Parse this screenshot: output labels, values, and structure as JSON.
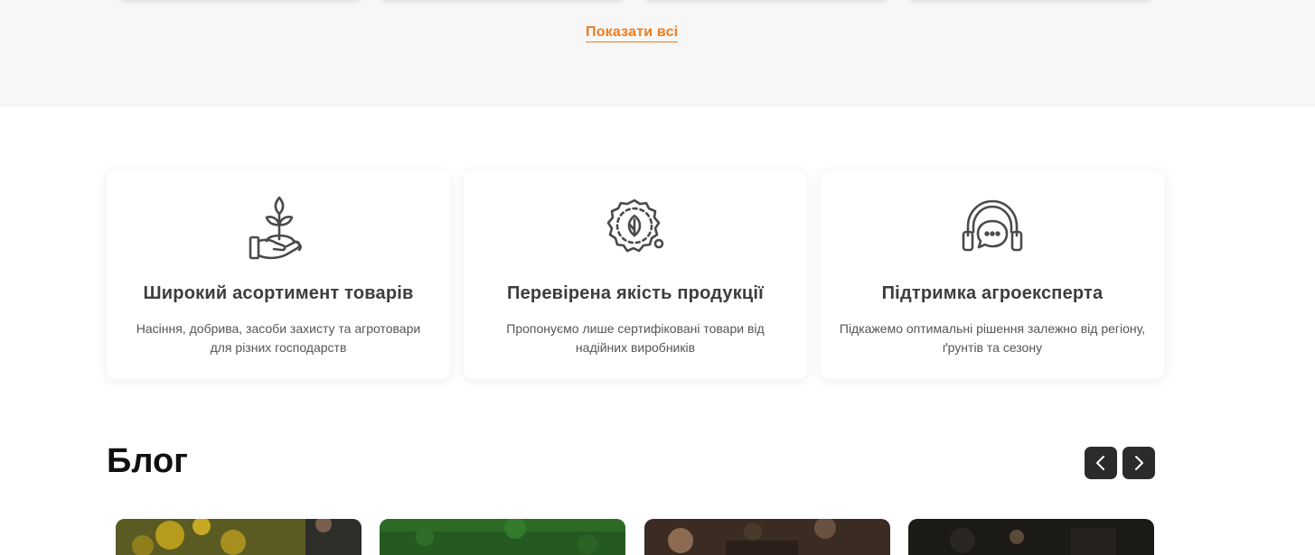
{
  "top": {
    "show_all_label": "Показати всі"
  },
  "features": [
    {
      "icon": "plant-hand-icon",
      "title": "Широкий асортимент товарів",
      "description": "Насіння, добрива, засоби захисту та агротовари для різних господарств"
    },
    {
      "icon": "quality-badge-icon",
      "title": "Перевірена якість продукції",
      "description": "Пропонуємо лише сертифіковані товари від надійних виробників"
    },
    {
      "icon": "headset-support-icon",
      "title": "Підтримка агроексперта",
      "description": "Підкажемо оптимальні рішення залежно від регіону, ґрунтів та сезону"
    }
  ],
  "blog": {
    "title": "Блог",
    "prev_icon": "chevron-left-icon",
    "next_icon": "chevron-right-icon"
  },
  "colors": {
    "accent": "#f07c1e",
    "section_bg": "#f7f7f7",
    "nav_button": "#2b2b2b"
  }
}
